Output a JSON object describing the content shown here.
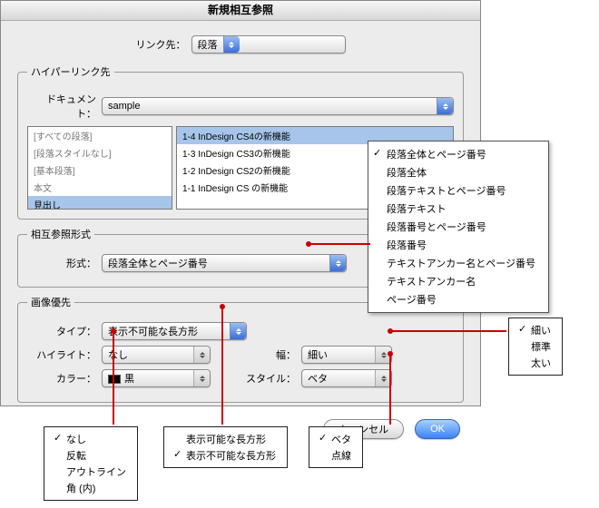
{
  "dialog": {
    "title": "新規相互参照",
    "link_label": "リンク先：",
    "link_value": "段落"
  },
  "dest_group": {
    "legend": "ハイパーリンク先",
    "doc_label": "ドキュメント：",
    "doc_value": "sample",
    "left_items": [
      "[すべての段落]",
      "[段落スタイルなし]",
      "[基本段落]",
      "本文",
      "見出し"
    ],
    "left_selected_index": 4,
    "right_items": [
      "1-4  InDesign CS4の新機能",
      "1-3  InDesign CS3の新機能",
      "1-2  InDesign CS2の新機能",
      "1-1  InDesign CS の新機能"
    ],
    "right_selected_index": 0
  },
  "format_group": {
    "legend": "相互参照形式",
    "format_label": "形式：",
    "format_value": "段落全体とページ番号"
  },
  "appearance_group": {
    "legend": "画像優先",
    "type_label": "タイプ：",
    "type_value": "表示不可能な長方形",
    "highlight_label": "ハイライト：",
    "highlight_value": "なし",
    "color_label": "カラー：",
    "color_value": "黒",
    "width_label": "幅：",
    "width_value": "細い",
    "style_label": "スタイル：",
    "style_value": "ベタ"
  },
  "buttons": {
    "cancel": "キャンセル",
    "ok": "OK"
  },
  "format_popup": {
    "options": [
      "段落全体とページ番号",
      "段落全体",
      "段落テキストとページ番号",
      "段落テキスト",
      "段落番号とページ番号",
      "段落番号",
      "テキストアンカー名とページ番号",
      "テキストアンカー名",
      "ページ番号"
    ],
    "checked_index": 0
  },
  "highlight_popup": {
    "options": [
      "なし",
      "反転",
      "アウトライン",
      "角 (内)"
    ],
    "checked_index": 0
  },
  "type_popup": {
    "options": [
      "表示可能な長方形",
      "表示不可能な長方形"
    ],
    "checked_index": 1
  },
  "style_popup": {
    "options": [
      "ベタ",
      "点線"
    ],
    "checked_index": 0
  },
  "width_popup": {
    "options": [
      "細い",
      "標準",
      "太い"
    ],
    "checked_index": 0
  }
}
